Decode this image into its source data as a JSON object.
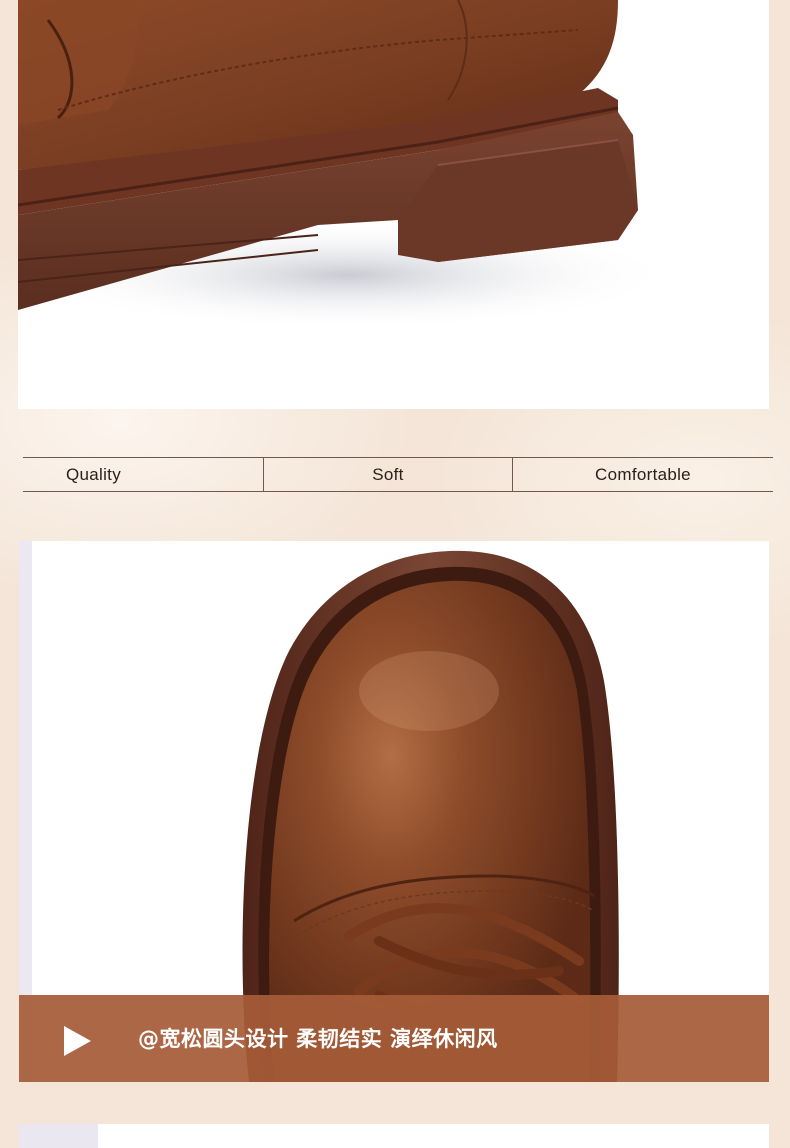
{
  "features": {
    "quality": "Quality",
    "soft": "Soft",
    "comfortable": "Comfortable"
  },
  "caption": {
    "text": "@宽松圆头设计  柔韧结实  演绎休闲风"
  },
  "colors": {
    "background": "#f4e5d8",
    "caption_bar": "#a65b38",
    "leather": "#7a3f22"
  },
  "icons": {
    "caption_play": "play-icon"
  }
}
